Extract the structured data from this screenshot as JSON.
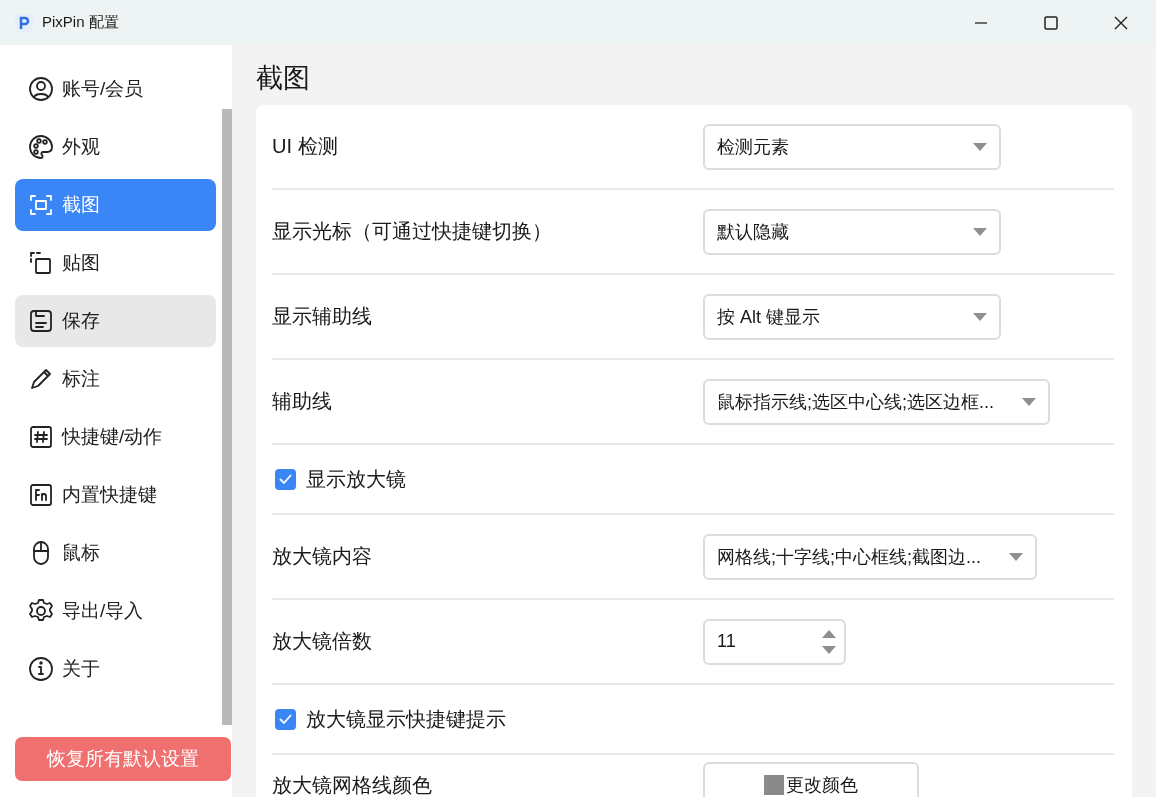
{
  "window": {
    "title": "PixPin 配置"
  },
  "sidebar": {
    "items": [
      {
        "label": "账号/会员",
        "selected": false,
        "hovered": false
      },
      {
        "label": "外观",
        "selected": false,
        "hovered": false
      },
      {
        "label": "截图",
        "selected": true,
        "hovered": false
      },
      {
        "label": "贴图",
        "selected": false,
        "hovered": false
      },
      {
        "label": "保存",
        "selected": false,
        "hovered": true
      },
      {
        "label": "标注",
        "selected": false,
        "hovered": false
      },
      {
        "label": "快捷键/动作",
        "selected": false,
        "hovered": false
      },
      {
        "label": "内置快捷键",
        "selected": false,
        "hovered": false
      },
      {
        "label": "鼠标",
        "selected": false,
        "hovered": false
      },
      {
        "label": "导出/导入",
        "selected": false,
        "hovered": false
      },
      {
        "label": "关于",
        "selected": false,
        "hovered": false
      }
    ],
    "reset_button": "恢复所有默认设置"
  },
  "page": {
    "title": "截图",
    "settings": [
      {
        "kind": "select",
        "label": "UI 检测",
        "value": "检测元素"
      },
      {
        "kind": "select",
        "label": "显示光标（可通过快捷键切换）",
        "value": "默认隐藏"
      },
      {
        "kind": "select",
        "label": "显示辅助线",
        "value": "按 Alt 键显示"
      },
      {
        "kind": "select",
        "label": "辅助线",
        "value": "鼠标指示线;选区中心线;选区边框..."
      },
      {
        "kind": "checkbox",
        "label": "显示放大镜",
        "checked": true
      },
      {
        "kind": "select",
        "label": "放大镜内容",
        "value": "网格线;十字线;中心框线;截图边..."
      },
      {
        "kind": "spinner",
        "label": "放大镜倍数",
        "value": "11"
      },
      {
        "kind": "checkbox",
        "label": "放大镜显示快捷键提示",
        "checked": true
      },
      {
        "kind": "color",
        "label": "放大镜网格线颜色",
        "button": "更改颜色"
      }
    ]
  }
}
